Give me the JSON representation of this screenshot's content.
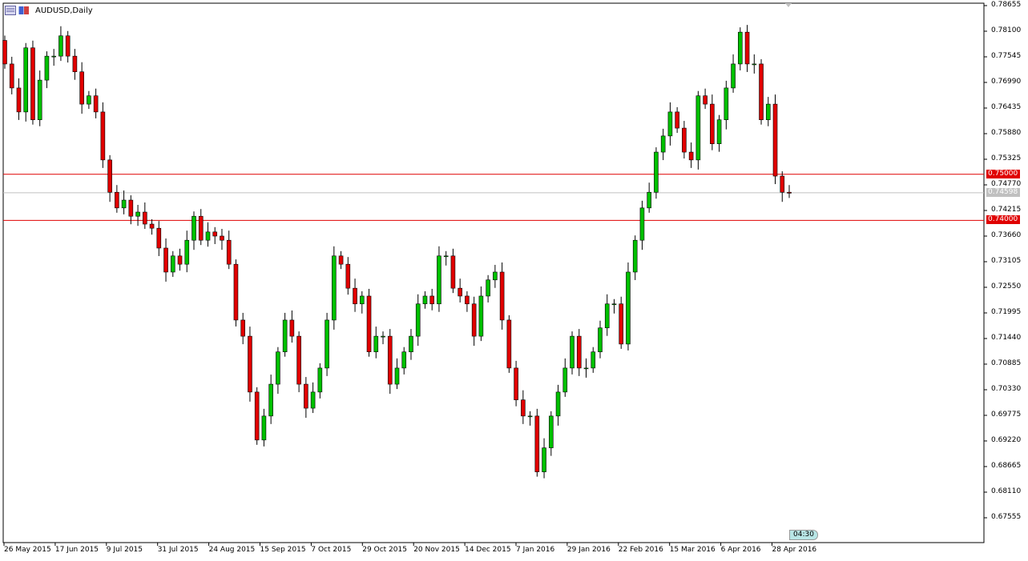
{
  "window": {
    "title": "AUDUSD,Daily",
    "timer": "04:30"
  },
  "colors": {
    "bull": "#00c000",
    "bear": "#e00000",
    "wick": "#000000",
    "level": "#e00000",
    "last": "#c0c0c0",
    "timer_bg": "#b8e6e6"
  },
  "chart_data": {
    "type": "candlestick",
    "title": "AUDUSD,Daily",
    "xlabel": "",
    "ylabel": "",
    "ylim": [
      0.67017,
      0.78707
    ],
    "y_ticks": [
      "0.78655",
      "0.78100",
      "0.77545",
      "0.76990",
      "0.76435",
      "0.75880",
      "0.75325",
      "0.74770",
      "0.74215",
      "0.73660",
      "0.73105",
      "0.72550",
      "0.71995",
      "0.71440",
      "0.70885",
      "0.70330",
      "0.69775",
      "0.69220",
      "0.68665",
      "0.68110",
      "0.67555"
    ],
    "x_ticks": [
      "26 May 2015",
      "17 Jun 2015",
      "9 Jul 2015",
      "31 Jul 2015",
      "24 Aug 2015",
      "15 Sep 2015",
      "7 Oct 2015",
      "29 Oct 2015",
      "20 Nov 2015",
      "14 Dec 2015",
      "7 Jan 2016",
      "29 Jan 2016",
      "22 Feb 2016",
      "15 Mar 2016",
      "6 Apr 2016",
      "28 Apr 2016"
    ],
    "first_open": 0.779,
    "close": [
      0.7739,
      0.7687,
      0.7635,
      0.7774,
      0.7618,
      0.7704,
      0.7756,
      0.7756,
      0.78,
      0.7756,
      0.7722,
      0.7652,
      0.767,
      0.7635,
      0.7531,
      0.7461,
      0.7427,
      0.7444,
      0.7409,
      0.7418,
      0.7392,
      0.7383,
      0.734,
      0.7288,
      0.7323,
      0.7305,
      0.7357,
      0.7409,
      0.7357,
      0.7375,
      0.7366,
      0.7357,
      0.7305,
      0.7184,
      0.7149,
      0.7028,
      0.6924,
      0.6976,
      0.7045,
      0.7115,
      0.7184,
      0.7149,
      0.7045,
      0.6993,
      0.7028,
      0.708,
      0.7184,
      0.7323,
      0.7305,
      0.7253,
      0.7219,
      0.7236,
      0.7115,
      0.7149,
      0.7149,
      0.7045,
      0.708,
      0.7115,
      0.7149,
      0.7219,
      0.7236,
      0.7219,
      0.7323,
      0.7323,
      0.7253,
      0.7236,
      0.7219,
      0.7149,
      0.7236,
      0.7271,
      0.7288,
      0.7184,
      0.708,
      0.7011,
      0.6976,
      0.6976,
      0.6855,
      0.6907,
      0.6976,
      0.7028,
      0.708,
      0.7149,
      0.708,
      0.708,
      0.7115,
      0.7167,
      0.7219,
      0.7219,
      0.7132,
      0.7288,
      0.7357,
      0.7427,
      0.7461,
      0.7548,
      0.7583,
      0.7635,
      0.76,
      0.7548,
      0.7531,
      0.767,
      0.7652,
      0.7566,
      0.7618,
      0.7687,
      0.7739,
      0.7808,
      0.7739,
      0.7739,
      0.7618,
      0.7652,
      0.7496,
      0.7461,
      0.7459
    ],
    "levels": [
      {
        "price": 0.75,
        "label": "0.75000",
        "kind": "level"
      },
      {
        "price": 0.74598,
        "label": "0.74598",
        "kind": "last"
      },
      {
        "price": 0.74,
        "label": "0.74000",
        "kind": "level"
      }
    ],
    "grid": false,
    "legend": "none"
  }
}
